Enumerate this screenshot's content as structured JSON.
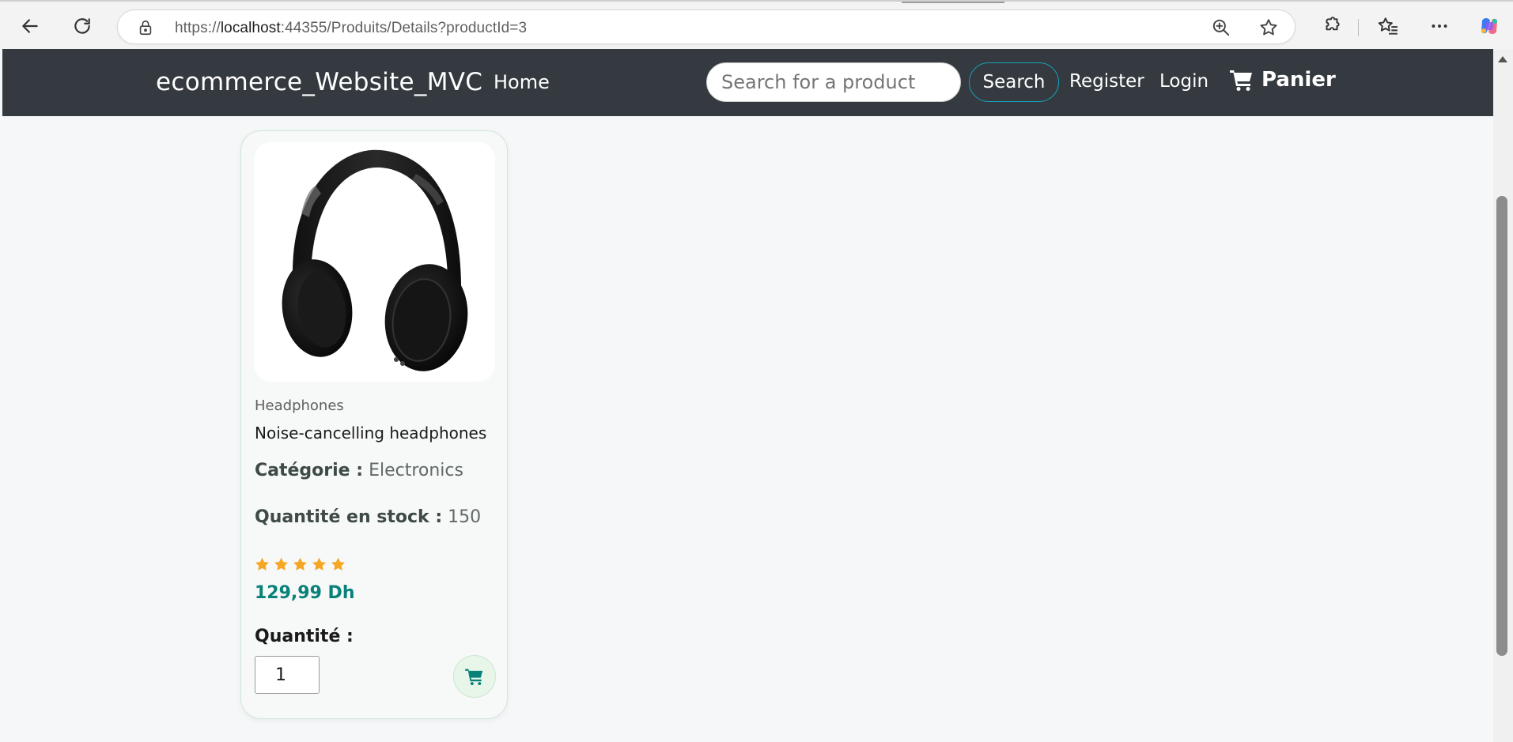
{
  "browser": {
    "url_prefix": "https://",
    "url_host": "localhost",
    "url_rest": ":44355/Produits/Details?productId=3"
  },
  "navbar": {
    "brand": "ecommerce_Website_MVC",
    "home": "Home",
    "search_placeholder": "Search for a product",
    "search_button": "Search",
    "register": "Register",
    "login": "Login",
    "cart": "Panier"
  },
  "product": {
    "brand": "Headphones",
    "name": "Noise-cancelling headphones",
    "category_label": "Catégorie :",
    "category_value": "Electronics",
    "stock_label": "Quantité en stock :",
    "stock_value": "150",
    "rating": 5,
    "price": "129,99 Dh",
    "quantity_label": "Quantité :",
    "quantity_value": "1"
  },
  "colors": {
    "navbar_bg": "#343a40",
    "price": "#088178",
    "star": "#f5a623"
  }
}
